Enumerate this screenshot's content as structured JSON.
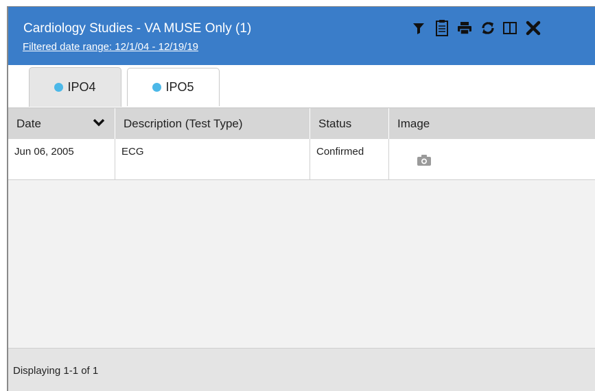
{
  "window": {
    "title": "Cardiology Studies - VA MUSE Only (1)",
    "filter_link": "Filtered date range: 12/1/04 - 12/19/19",
    "header_color": "#3a7dc9"
  },
  "toolbar": {
    "icons": [
      "filter-icon",
      "clipboard-icon",
      "print-icon",
      "refresh-icon",
      "expand-panel-icon",
      "close-icon"
    ]
  },
  "tabs": [
    {
      "label": "IPO4",
      "active": true,
      "dot_color": "#4cb8e8"
    },
    {
      "label": "IPO5",
      "active": false,
      "dot_color": "#4cb8e8"
    }
  ],
  "table": {
    "columns": [
      "Date",
      "Description (Test Type)",
      "Status",
      "Image"
    ],
    "sort_indicator": "chevron-down-icon",
    "rows": [
      {
        "date": "Jun 06, 2005",
        "description": "ECG",
        "status": "Confirmed",
        "image": "camera-icon"
      }
    ]
  },
  "footer": {
    "text": "Displaying 1-1 of 1"
  }
}
